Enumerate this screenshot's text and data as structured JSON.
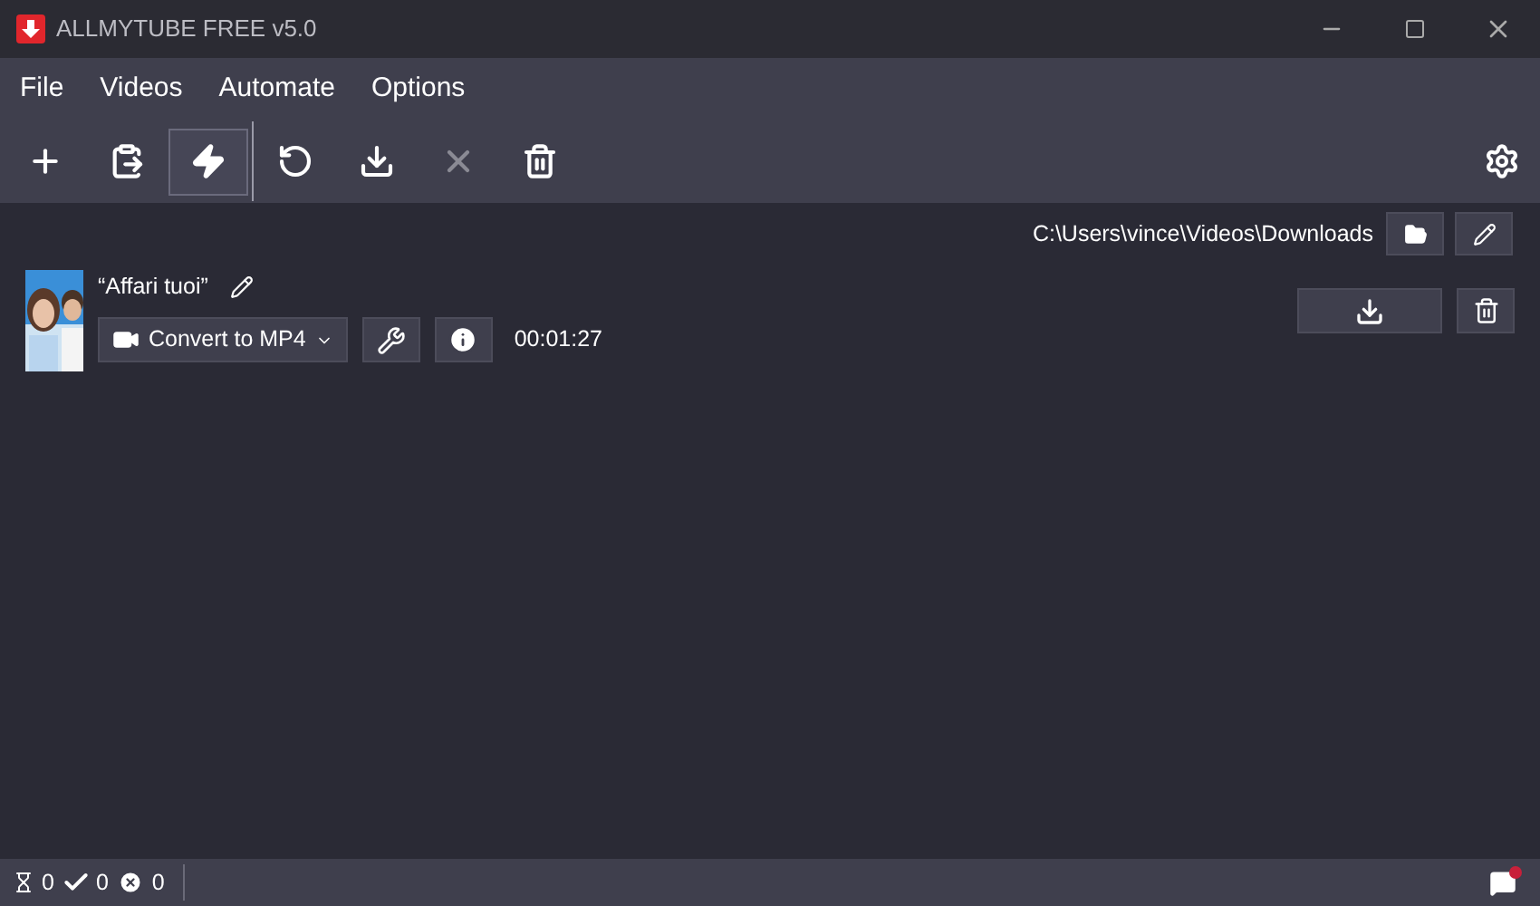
{
  "window": {
    "title": "ALLMYTUBE FREE v5.0"
  },
  "menu": [
    "File",
    "Videos",
    "Automate",
    "Options"
  ],
  "toolbar": [
    {
      "kind": "add",
      "selected": false,
      "disabled": false
    },
    {
      "kind": "paste",
      "selected": false,
      "disabled": false
    },
    {
      "kind": "turbo",
      "selected": true,
      "disabled": false
    },
    {
      "kind": "refresh",
      "selected": false,
      "disabled": false
    },
    {
      "kind": "download",
      "selected": false,
      "disabled": false
    },
    {
      "kind": "cancel",
      "selected": false,
      "disabled": true
    },
    {
      "kind": "delete",
      "selected": false,
      "disabled": false
    }
  ],
  "output_path": "C:\\Users\\vince\\Videos\\Downloads",
  "videos": [
    {
      "title": "“Affari tuoi”",
      "format": "Convert to MP4",
      "duration": "00:01:27"
    }
  ],
  "status_bar": {
    "waiting": "0",
    "done": "0",
    "failed": "0",
    "unread_messages": true
  }
}
